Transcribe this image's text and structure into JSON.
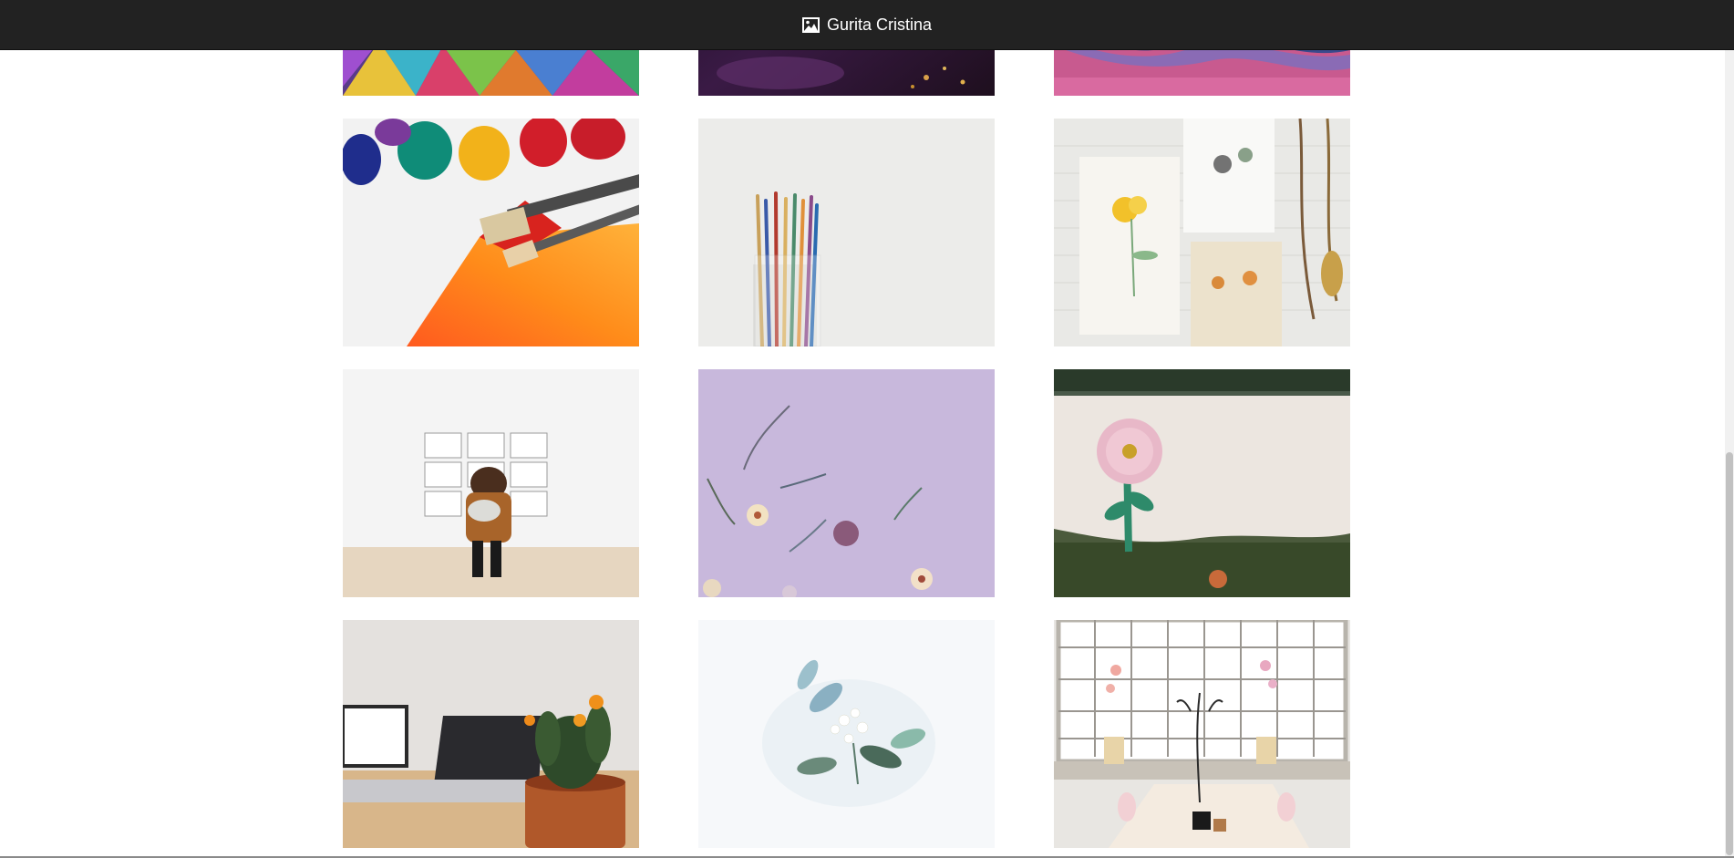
{
  "navbar": {
    "brand_label": "Gurita Cristina",
    "brand_icon": "picture-icon",
    "background_color": "#222222",
    "text_color": "#ffffff"
  },
  "gallery": {
    "items": [
      {
        "name": "colorful-triangles-photo"
      },
      {
        "name": "dark-purple-paint-photo"
      },
      {
        "name": "pink-blue-paint-photo"
      },
      {
        "name": "paint-brushes-orange-photo"
      },
      {
        "name": "brushes-in-jar-photo"
      },
      {
        "name": "botanical-prints-photo"
      },
      {
        "name": "woman-at-gallery-photo"
      },
      {
        "name": "flowers-on-purple-photo"
      },
      {
        "name": "painted-flower-wall-photo"
      },
      {
        "name": "laptop-cactus-photo"
      },
      {
        "name": "white-flower-bouquet-photo"
      },
      {
        "name": "window-orchids-table-photo"
      }
    ]
  }
}
